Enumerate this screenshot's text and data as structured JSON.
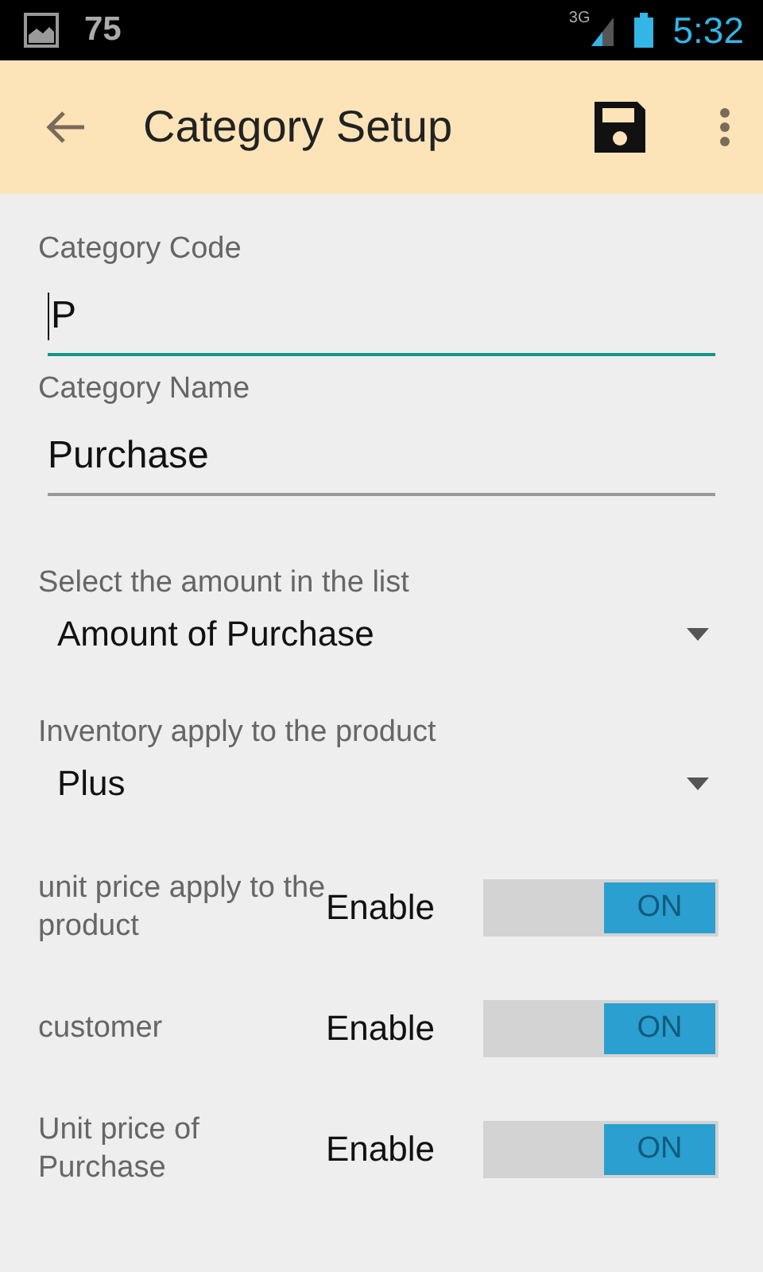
{
  "status_bar": {
    "notification_count": "75",
    "network": "3G",
    "time": "5:32"
  },
  "app_bar": {
    "title": "Category Setup"
  },
  "fields": [
    {
      "label": "Category Code",
      "value": "P",
      "focused": true
    },
    {
      "label": "Category Name",
      "value": "Purchase",
      "focused": false
    }
  ],
  "dropdowns": [
    {
      "label": "Select the amount in the list",
      "value": "Amount of Purchase"
    },
    {
      "label": "Inventory apply to the product",
      "value": "Plus"
    }
  ],
  "toggles": [
    {
      "label": "unit price apply to the product",
      "state_label": "Enable",
      "switch_text": "ON",
      "on": true
    },
    {
      "label": "customer",
      "state_label": "Enable",
      "switch_text": "ON",
      "on": true
    },
    {
      "label": "Unit price of Purchase",
      "state_label": "Enable",
      "switch_text": "ON",
      "on": true
    }
  ]
}
